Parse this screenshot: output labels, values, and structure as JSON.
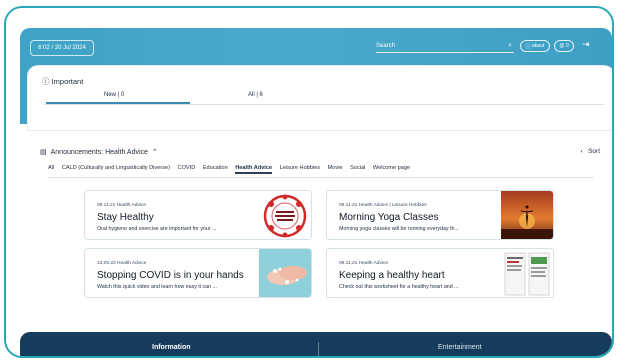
{
  "header": {
    "datetime": "6:02 / 20 Jul 2024",
    "search_placeholder": "Search",
    "about_label": "about",
    "count_label": "0",
    "search_icon": "search-icon",
    "signout_icon": "signout-icon"
  },
  "important": {
    "title": "Important",
    "tabs": [
      {
        "label": "New | 0"
      },
      {
        "label": "All | 6"
      }
    ]
  },
  "announcements": {
    "title": "Announcements: Health Advice",
    "sort_label": "Sort",
    "categories": [
      "All",
      "CALD (Culturally and Linguistically Diverse)",
      "COVID",
      "Education",
      "Health Advice",
      "Leisure Hobbies",
      "Movie",
      "Social",
      "Welcome page"
    ],
    "active_category": "Health Advice",
    "cards": [
      {
        "meta": "09.11.21 Health Advice",
        "title": "Stay Healthy",
        "desc": "Oral hygiene and exercise are important for your ..."
      },
      {
        "meta": "09.11.21 Health Advice | Leisure Hobbies",
        "title": "Morning Yoga Classes",
        "desc": "Morning yoga classes will be running everyday th..."
      },
      {
        "meta": "13.05.22 Health Advice",
        "title": "Stopping COVID is in your hands",
        "desc": "Watch this quick video and learn how easy it can ..."
      },
      {
        "meta": "09.11.21 Health Advice",
        "title": "Keeping a healthy heart",
        "desc": "Check out this worksheet for a healthy heart and ..."
      }
    ]
  },
  "bottom_nav": {
    "info_label": "Information",
    "ent_label": "Entertainment"
  },
  "colors": {
    "top_bar": "#3ea3c6",
    "bottom_bar": "#153c5c",
    "frame": "#2aa7b8"
  }
}
